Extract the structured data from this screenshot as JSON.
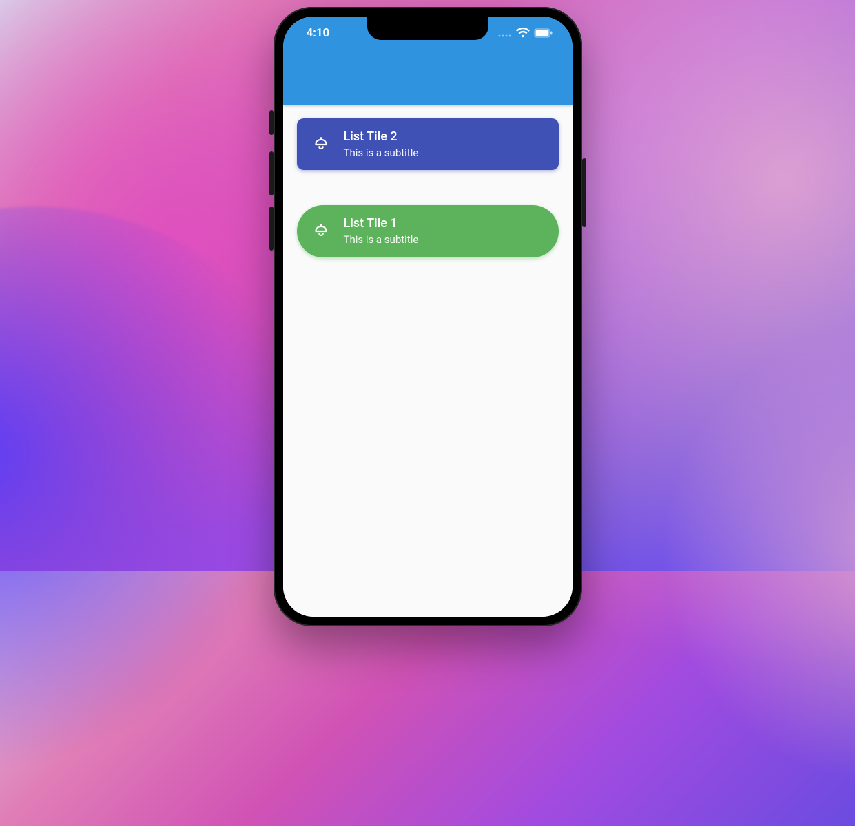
{
  "status_bar": {
    "time": "4:10"
  },
  "tiles": [
    {
      "title": "List Tile 2",
      "subtitle": "This is a subtitle",
      "bg_color": "#3f51b5",
      "style": "rounded-rect"
    },
    {
      "title": "List Tile 1",
      "subtitle": "This is a subtitle",
      "bg_color": "#5cb35c",
      "style": "pill"
    }
  ],
  "colors": {
    "app_bar": "#2f93e0",
    "screen_bg": "#fafafa"
  }
}
